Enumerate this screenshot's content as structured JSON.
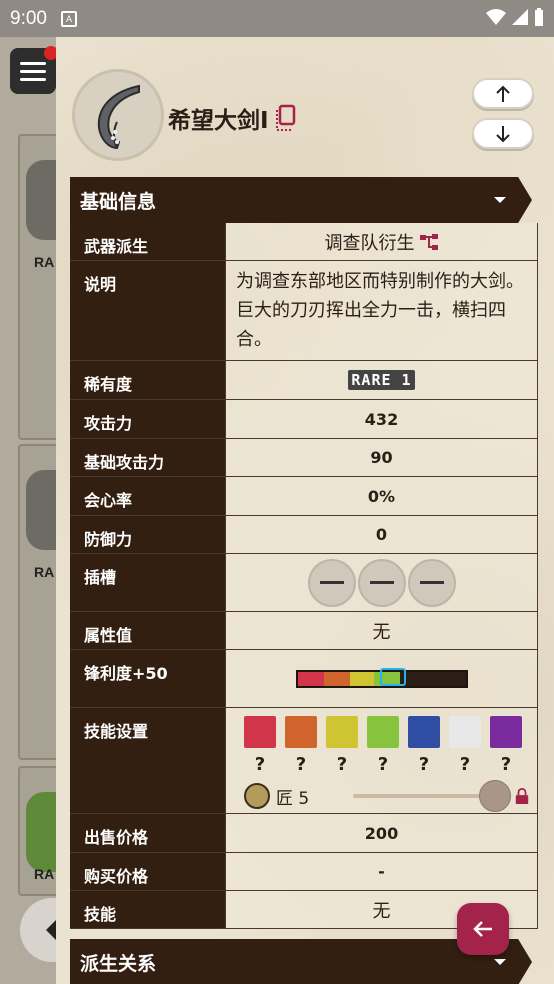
{
  "status": {
    "time": "9:00",
    "notif_icon": "A"
  },
  "weapon": {
    "name": "希望大剑I"
  },
  "sections": {
    "basic": "基础信息",
    "derive": "派生关系"
  },
  "rows": {
    "derive": {
      "label": "武器派生",
      "value": "调查队衍生"
    },
    "desc": {
      "label": "说明",
      "value": "为调查东部地区而特别制作的大剑。巨大的刀刃挥出全力一击，横扫四合。"
    },
    "rarity": {
      "label": "稀有度",
      "value": "RARE 1"
    },
    "attack": {
      "label": "攻击力",
      "value": "432"
    },
    "base_attack": {
      "label": "基础攻击力",
      "value": "90"
    },
    "affinity": {
      "label": "会心率",
      "value": "0%"
    },
    "defense": {
      "label": "防御力",
      "value": "0"
    },
    "slots": {
      "label": "插槽"
    },
    "element": {
      "label": "属性值",
      "value": "无"
    },
    "sharpness": {
      "label": "锋利度+50",
      "level": 0.6
    },
    "skills_setting": {
      "label": "技能设置",
      "question": "?",
      "handicraft": "匠 5",
      "handicraft_level": 5
    },
    "sell": {
      "label": "出售价格",
      "value": "200"
    },
    "buy": {
      "label": "购买价格",
      "value": "-"
    },
    "skills": {
      "label": "技能",
      "value": "无"
    }
  },
  "colors": {
    "accent": "#a4234a",
    "header": "#331f11",
    "swatches": [
      "#d2344a",
      "#d0642d",
      "#cfc431",
      "#85c43c",
      "#2f4ea4",
      "#e8e8e8",
      "#7a2c9e"
    ]
  },
  "background": {
    "rare_label": "RA"
  }
}
